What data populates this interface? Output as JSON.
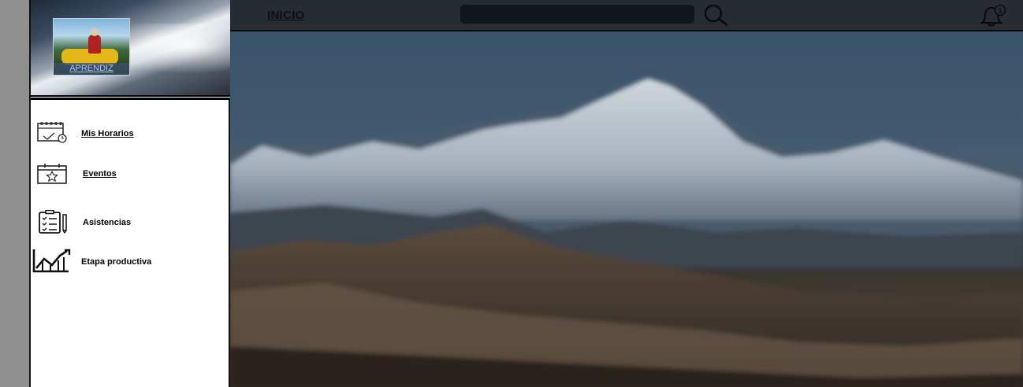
{
  "app": {
    "background_accent": "#262c32"
  },
  "profile": {
    "role_label": "APRENDIZ",
    "avatar_icon": "avatar-photo"
  },
  "menu": {
    "items": [
      {
        "label": "Mis Horarios",
        "icon": "calendar-clock-icon",
        "underlined": true
      },
      {
        "label": "Eventos",
        "icon": "calendar-star-icon",
        "underlined": true
      },
      {
        "label": "Asistencias",
        "icon": "clipboard-checklist-icon",
        "underlined": false
      },
      {
        "label": "Etapa productiva",
        "icon": "chart-trend-icon",
        "underlined": false
      }
    ]
  },
  "topbar": {
    "home_link": "INICIO",
    "search_placeholder": "",
    "search_icon": "magnifier-icon",
    "notifications": {
      "icon": "bell-icon",
      "count": "1"
    }
  },
  "hero": {
    "image": "snow-capped-mountain-landscape"
  }
}
